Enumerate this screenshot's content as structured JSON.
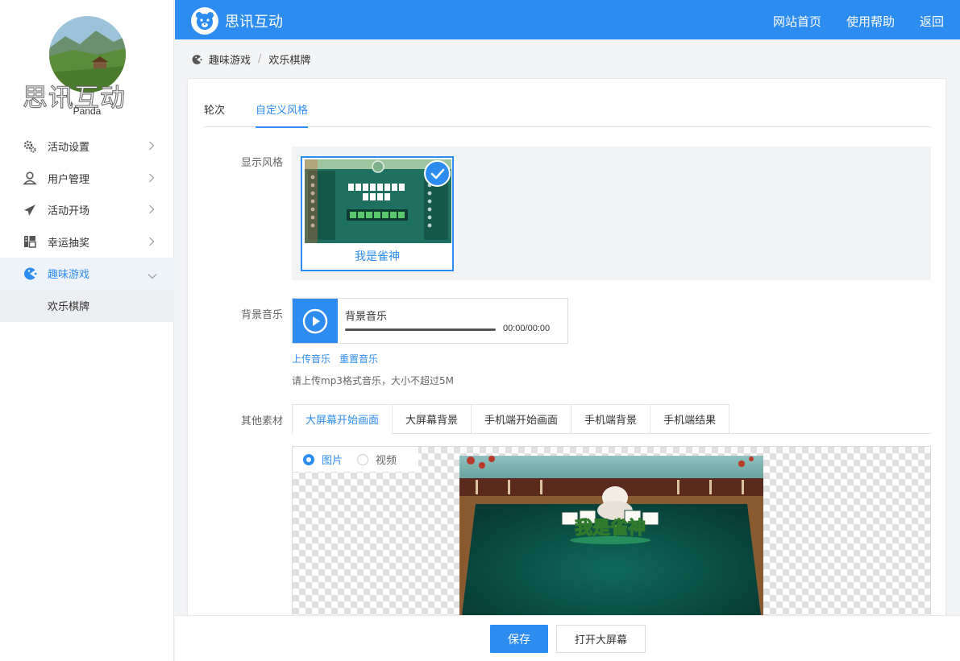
{
  "sidebar": {
    "logo_text": "思讯互动",
    "username": "Panda",
    "items": [
      {
        "label": "活动设置",
        "icon": "gears-icon"
      },
      {
        "label": "用户管理",
        "icon": "user-icon"
      },
      {
        "label": "活动开场",
        "icon": "paper-plane-icon"
      },
      {
        "label": "幸运抽奖",
        "icon": "lottery-icon"
      },
      {
        "label": "趣味游戏",
        "icon": "pacman-icon"
      }
    ],
    "submenu_label": "欢乐棋牌"
  },
  "topbar": {
    "brand": "思讯互动",
    "nav": [
      "网站首页",
      "使用帮助",
      "返回"
    ]
  },
  "breadcrumb": {
    "items": [
      "趣味游戏",
      "欢乐棋牌"
    ],
    "separator": "/"
  },
  "tabs": {
    "items": [
      "轮次",
      "自定义风格"
    ],
    "active": 1
  },
  "style": {
    "label": "显示风格",
    "selected_name": "我是雀神"
  },
  "music": {
    "label": "背景音乐",
    "title": "背景音乐",
    "time": "00:00/00:00",
    "upload_link": "上传音乐",
    "reset_link": "重置音乐",
    "hint": "请上传mp3格式音乐，大小不超过5M"
  },
  "assets": {
    "label": "其他素材",
    "tabs": [
      "大屏幕开始画面",
      "大屏幕背景",
      "手机端开始画面",
      "手机端背景",
      "手机端结果"
    ],
    "active_tab": 0,
    "radio_image": "图片",
    "radio_video": "视频",
    "selected_radio": "图片",
    "preview_title": "我是雀神"
  },
  "footer": {
    "save": "保存",
    "open_screen": "打开大屏幕"
  },
  "colors": {
    "primary": "#2d8cf0",
    "topbar": "#2d8cf0"
  }
}
